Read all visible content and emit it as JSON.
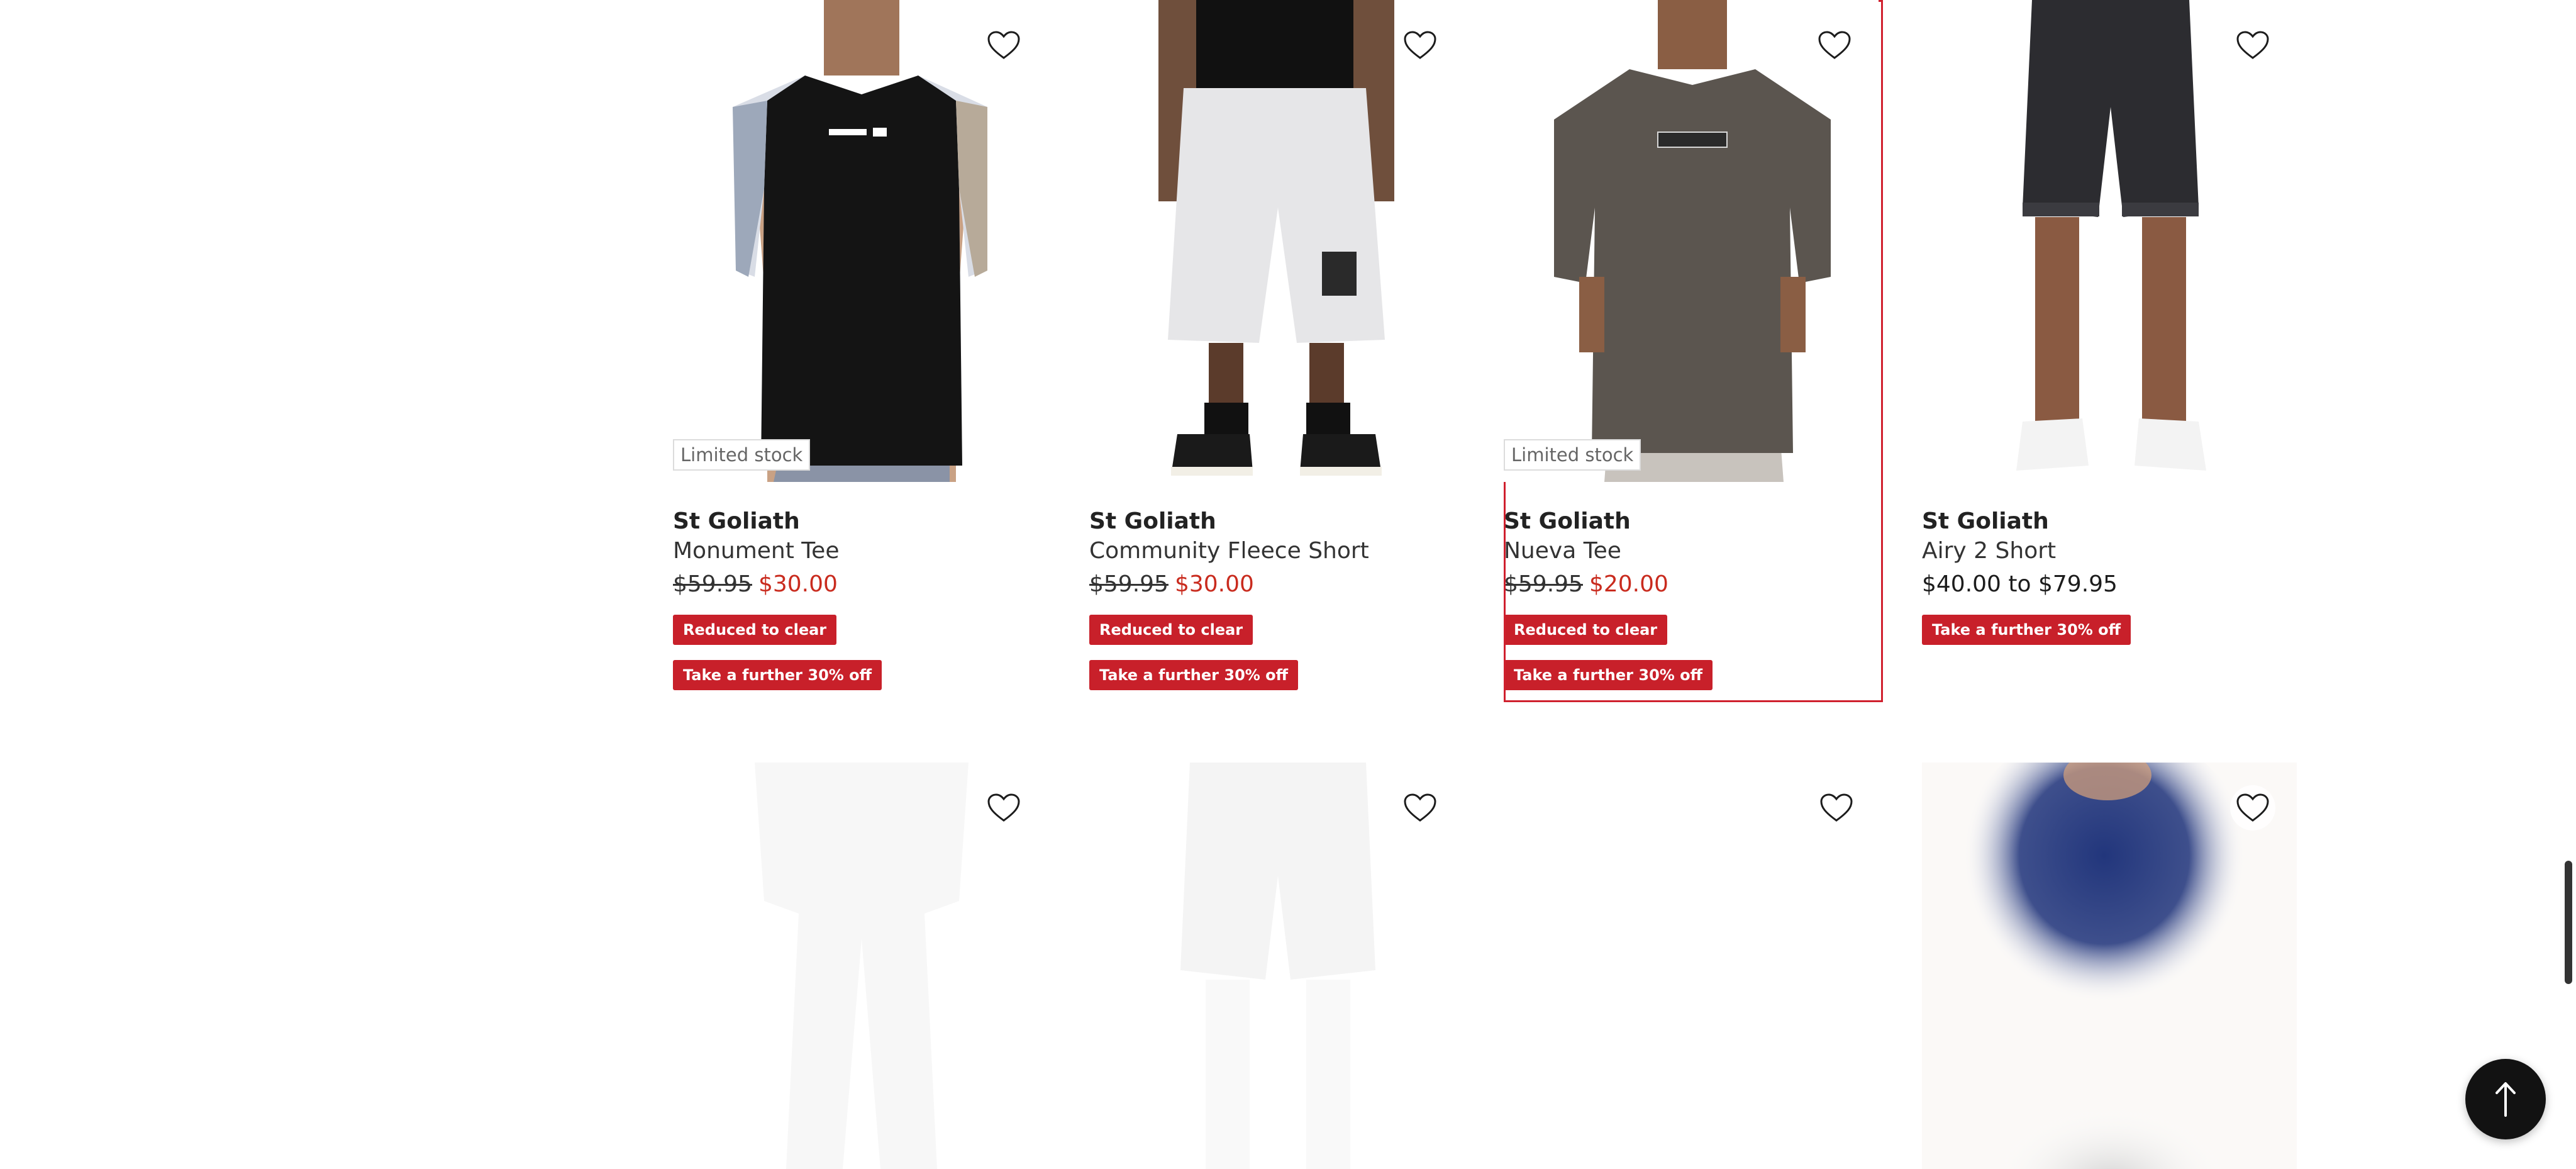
{
  "products": [
    {
      "brand": "St Goliath",
      "name": "Monument Tee",
      "price_was": "$59.95",
      "price_now": "$30.00",
      "stock_badge": "Limited stock",
      "tags": [
        "Reduced to clear",
        "Take a further 30% off"
      ],
      "image": "black tee with tie-dye sleeves, printed chest logo"
    },
    {
      "brand": "St Goliath",
      "name": "Community Fleece Short",
      "price_was": "$59.95",
      "price_now": "$30.00",
      "tags": [
        "Reduced to clear",
        "Take a further 30% off"
      ],
      "image": "grey fleece shorts with black high-top sneakers"
    },
    {
      "brand": "St Goliath",
      "name": "Nueva Tee",
      "price_was": "$59.95",
      "price_now": "$20.00",
      "stock_badge": "Limited stock",
      "tags": [
        "Reduced to clear",
        "Take a further 30% off"
      ],
      "image": "charcoal raglan tee with small chest label"
    },
    {
      "brand": "St Goliath",
      "name": "Airy 2 Short",
      "price_range": "$40.00 to $79.95",
      "tags": [
        "Take a further 30% off"
      ],
      "image": "black denim shorts with white sneakers"
    }
  ],
  "colors": {
    "sale_red": "#c92b1e",
    "tag_red": "#c8202a",
    "selected_outline": "#d0202e",
    "back_to_top_bg": "#121212"
  },
  "icons": {
    "wishlist": "heart-outline-icon",
    "back_to_top": "arrow-up-icon"
  }
}
